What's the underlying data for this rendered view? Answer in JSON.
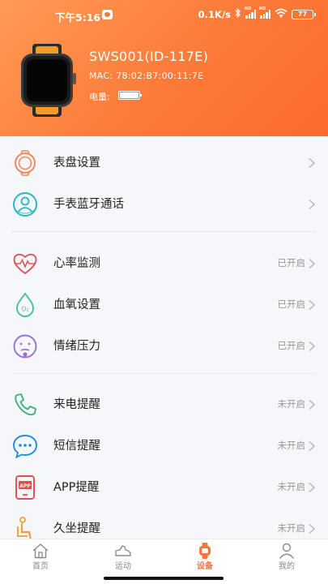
{
  "status_bar": {
    "time": "下午5:16",
    "speed": "0.1K/s",
    "sig1_label": "HD",
    "sig2_label": "HD",
    "battery": "77"
  },
  "device": {
    "name": "SWS001(ID-117E)",
    "mac": "MAC: 78:02:B7:00:11:7E",
    "battery_label": "电量:",
    "battery_level": 1.0
  },
  "menu": [
    {
      "label": "表盘设置",
      "status": "",
      "icon": "watch-face-icon"
    },
    {
      "label": "手表蓝牙通话",
      "status": "",
      "icon": "bluetooth-call-icon"
    },
    {
      "label": "心率监测",
      "status": "已开启",
      "icon": "heart-rate-icon"
    },
    {
      "label": "血氧设置",
      "status": "已开启",
      "icon": "blood-oxygen-icon"
    },
    {
      "label": "情绪压力",
      "status": "已开启",
      "icon": "mood-stress-icon"
    },
    {
      "label": "来电提醒",
      "status": "未开启",
      "icon": "phone-icon"
    },
    {
      "label": "短信提醒",
      "status": "未开启",
      "icon": "sms-icon"
    },
    {
      "label": "APP提醒",
      "status": "未开启",
      "icon": "app-icon"
    },
    {
      "label": "久坐提醒",
      "status": "未开启",
      "icon": "sedentary-icon"
    }
  ],
  "app_icon_text": "APP",
  "o2_text": "O₂",
  "tabs": [
    {
      "label": "首页",
      "active": false
    },
    {
      "label": "运动",
      "active": false
    },
    {
      "label": "设备",
      "active": true
    },
    {
      "label": "我的",
      "active": false
    }
  ],
  "colors": {
    "accent": "#f7743a",
    "header": "#fd7a38"
  }
}
